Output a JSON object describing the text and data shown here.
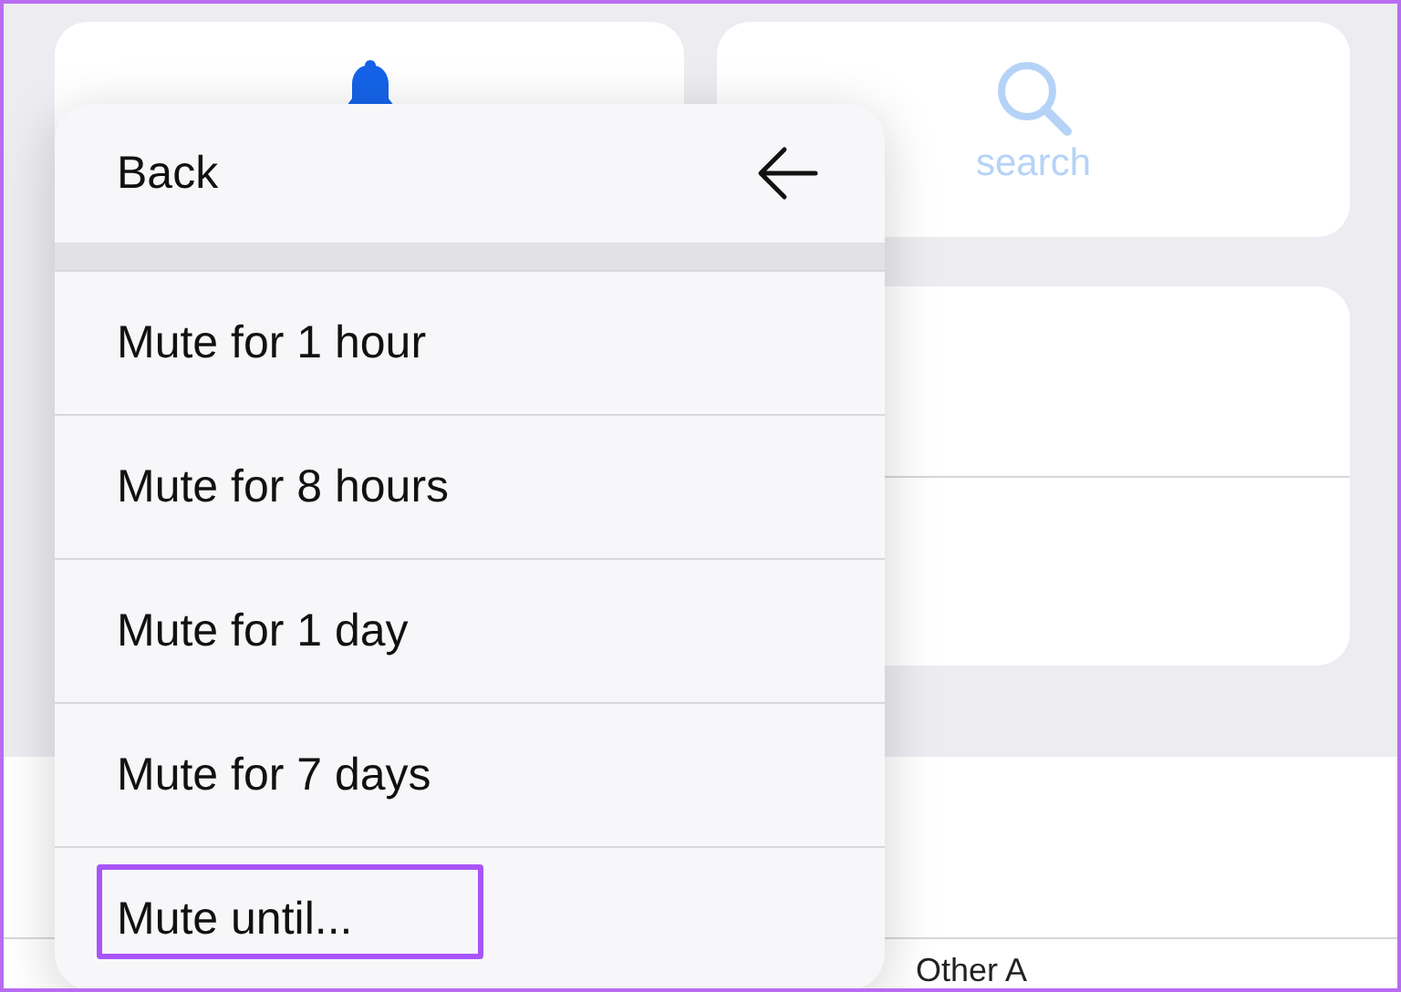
{
  "tiles": [
    {
      "kind": "bell"
    },
    {
      "kind": "search",
      "label": "search"
    }
  ],
  "footer_text": "Other A",
  "menu": {
    "header": "Back",
    "items": [
      {
        "label": "Mute for 1 hour",
        "highlighted": false
      },
      {
        "label": "Mute for 8 hours",
        "highlighted": false
      },
      {
        "label": "Mute for 1 day",
        "highlighted": false
      },
      {
        "label": "Mute for 7 days",
        "highlighted": false
      },
      {
        "label": "Mute until...",
        "highlighted": true
      }
    ]
  }
}
